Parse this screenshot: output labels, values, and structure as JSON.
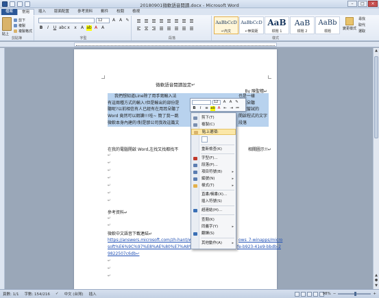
{
  "window": {
    "title": "20180901微軟語音閱讀.docx - Microsoft Word",
    "controls": [
      "–",
      "□",
      "×"
    ]
  },
  "tabs": [
    "檔案",
    "常用",
    "插入",
    "版面配置",
    "參考資料",
    "郵件",
    "校閱",
    "檢視"
  ],
  "ribbon": {
    "clipboard": {
      "paste": "貼上",
      "cut": "剪下",
      "copy": "複製",
      "format_painter": "複製格式",
      "label": "剪貼簿"
    },
    "font": {
      "name": "",
      "size": "12",
      "label": "字型"
    },
    "paragraph": {
      "label": "段落"
    },
    "styles": {
      "items": [
        {
          "sample": "AaBbCcD",
          "name": "↵內文"
        },
        {
          "sample": "AaBbCcD",
          "name": "↵無間距"
        },
        {
          "sample": "AaB",
          "name": "標題 1"
        },
        {
          "sample": "AaB",
          "name": "標題 2"
        },
        {
          "sample": "AaBb",
          "name": "標題"
        }
      ],
      "change": "變更樣式",
      "label": "樣式"
    },
    "editing": [
      "尋找",
      "取代",
      "選取"
    ]
  },
  "document": {
    "title": "微軟語音閱讀設定↵",
    "byline": "By 陳聖穗↵",
    "selected_lines": [
      "我們想知道Line除了用手寫輸入法",
      "有這兩種方式的輸入!但是輸出的部份是",
      "聽呢?以前相信有人已經有在用耳朵聽了",
      "Word 竟然可以朗讀!!!哇~ 簡了我一跳",
      "微軟本身內建的!對是那公司我改這篇文"
    ],
    "selected_right_fragments": [
      "也是一樣",
      "用耳朵聽",
      "才能嘗試的",
      "開啟程式的文字段落",
      ""
    ],
    "line_before_list": "在我的電腦開啟 Word,左找又找都找不",
    "line_before_list_end": "相關圖示!!↵",
    "reference_heading": "參考資料↵",
    "download_heading": "微軟中文語音下載連結↵",
    "link_lines": [
      "https://answers.microsoft.com/zh-hant/w",
      "soft%E6%9C%97%E8%AE%80%E7%A8%8E",
      "9822507c6db↵"
    ],
    "link_right_fragments": [
      "ows_7-winapps/micro",
      "fe-b923-41e9-bbdb-2"
    ],
    "para_mark": "↵"
  },
  "mini_toolbar": {
    "font": "",
    "size": "12"
  },
  "context_menu": [
    {
      "label": "剪下(T)",
      "icon": "scissors-icon",
      "color": "#7a8fb0"
    },
    {
      "label": "複製(C)",
      "icon": "copy-icon",
      "color": "#7a8fb0"
    },
    {
      "label": "貼上選項:",
      "icon": "paste-icon",
      "color": "#d9b36b"
    },
    {
      "label": "重新檢查(K)",
      "icon": "",
      "color": ""
    },
    {
      "label": "字型(F)...",
      "icon": "font-icon",
      "color": "#c0392b"
    },
    {
      "label": "段落(P)...",
      "icon": "paragraph-icon",
      "color": "#5b7db1"
    },
    {
      "label": "項目符號(B)",
      "icon": "bullets-icon",
      "color": "#5b7db1"
    },
    {
      "label": "編號(N)",
      "icon": "numbering-icon",
      "color": "#5b7db1"
    },
    {
      "label": "樣式(T)",
      "icon": "styles-icon",
      "color": "#e3b04b"
    },
    {
      "label": "直書/橫書(X)...",
      "icon": "",
      "color": ""
    },
    {
      "label": "插入符號(S)",
      "icon": "",
      "color": ""
    },
    {
      "label": "超連結(H)...",
      "icon": "hyperlink-icon",
      "color": "#3a6fb5"
    },
    {
      "label": "查閱(K)",
      "icon": "",
      "color": ""
    },
    {
      "label": "同義字(Y)",
      "icon": "",
      "color": ""
    },
    {
      "label": "翻譯(S)",
      "icon": "translate-icon",
      "color": "#3a6fb5"
    },
    {
      "label": "其他動作(A)",
      "icon": "",
      "color": ""
    }
  ],
  "status": {
    "page": "頁數: 1/1",
    "words": "字數: 154/216",
    "lang": "中文 (台灣)",
    "mode": "插入",
    "zoom": "98%",
    "zoom_fraction": 0.49
  }
}
